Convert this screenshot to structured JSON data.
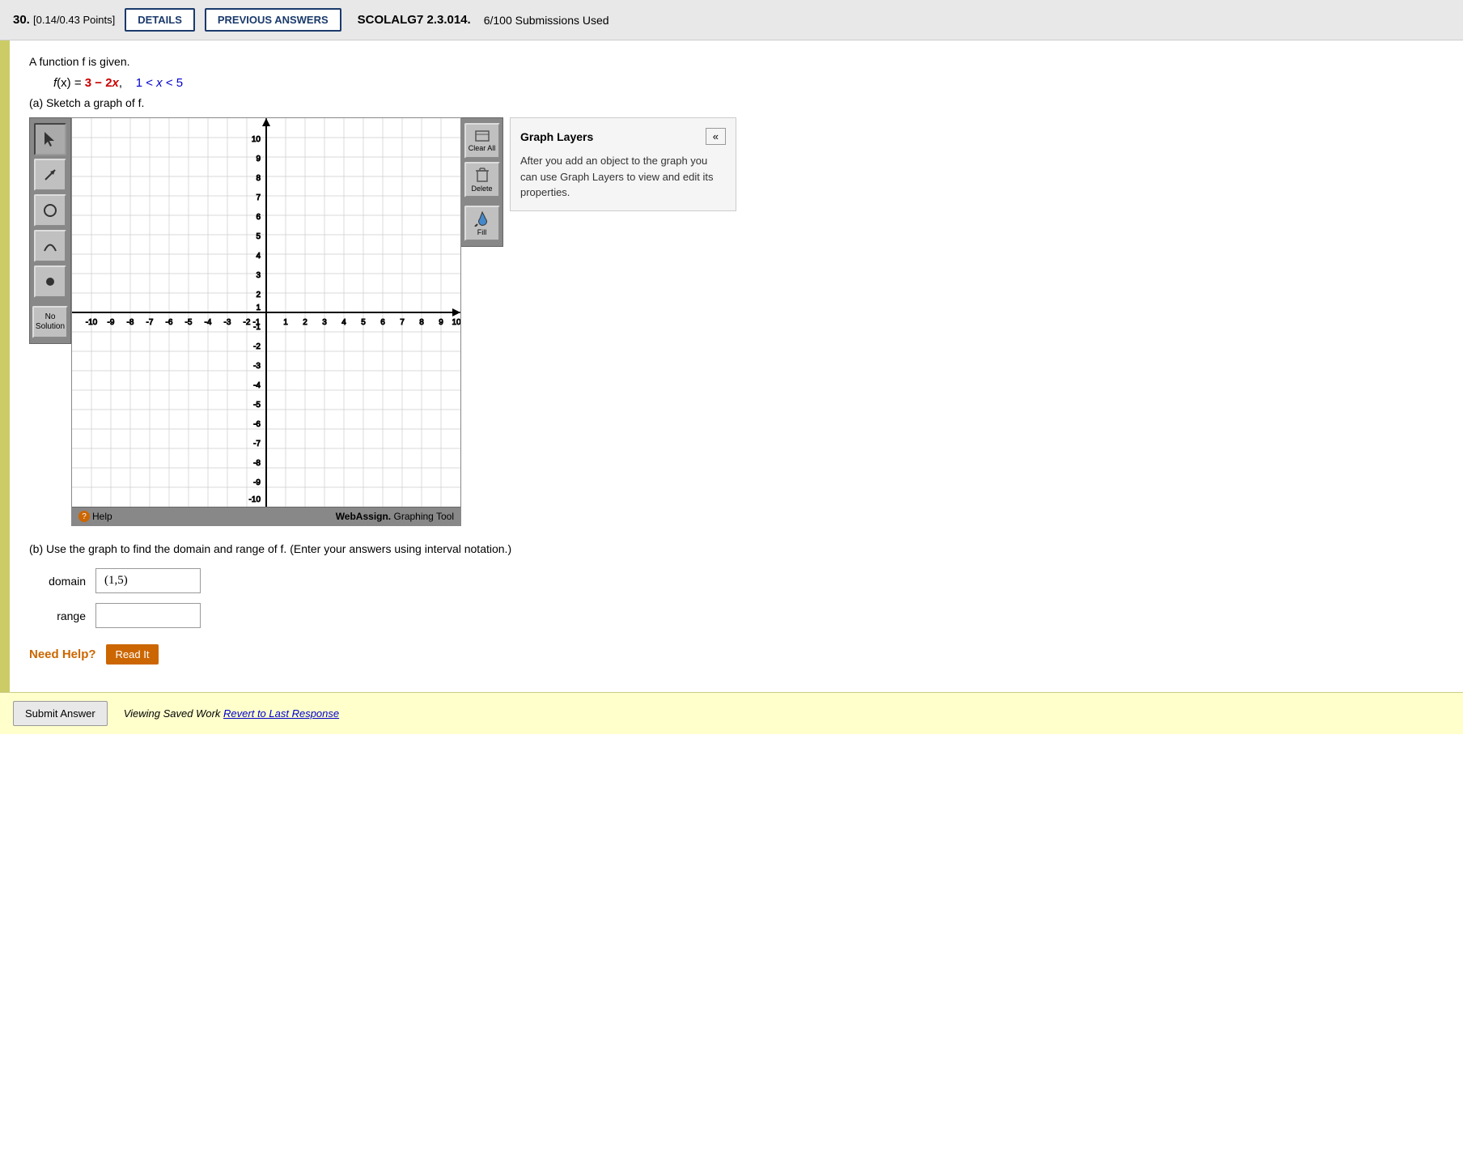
{
  "header": {
    "question_number": "30.",
    "points": "[0.14/0.43 Points]",
    "details_label": "DETAILS",
    "prev_answers_label": "PREVIOUS ANSWERS",
    "course_code": "SCOLALG7 2.3.014.",
    "submissions": "6/100 Submissions Used"
  },
  "problem": {
    "statement": "A function f is given.",
    "function_display": "f(x) = 3 − 2x,    1 < x < 5",
    "part_a_label": "(a) Sketch a graph of f.",
    "part_b_label": "(b) Use the graph to find the domain and range of f. (Enter your answers using interval notation.)"
  },
  "toolbar": {
    "cursor_tool": "▲",
    "arrow_tool": "↗",
    "circle_tool": "○",
    "parabola_tool": "∪",
    "dot_tool": "●",
    "no_solution_label": "No\nSolution"
  },
  "side_panel": {
    "clear_all_label": "Clear All",
    "delete_label": "Delete",
    "fill_label": "Fill"
  },
  "graph_layers": {
    "title": "Graph Layers",
    "collapse_icon": "«",
    "description": "After you add an object to the graph you can use Graph Layers to view and edit its properties."
  },
  "graph": {
    "x_min": -10,
    "x_max": 10,
    "y_min": -10,
    "y_max": 10,
    "x_labels": [
      "-10",
      "-9",
      "-8",
      "-7",
      "-6",
      "-5",
      "-4",
      "-3",
      "-2",
      "-1",
      "1",
      "2",
      "3",
      "4",
      "5",
      "6",
      "7",
      "8",
      "9",
      "10"
    ],
    "y_labels": [
      "-10",
      "-9",
      "-8",
      "-7",
      "-6",
      "-5",
      "-4",
      "-3",
      "-2",
      "-1",
      "1",
      "2",
      "3",
      "4",
      "5",
      "6",
      "7",
      "8",
      "9",
      "10"
    ]
  },
  "webassign_credit": "WebAssign. Graphing Tool",
  "help_label": "Help",
  "answers": {
    "domain_label": "domain",
    "domain_value": "(1,5)",
    "range_label": "range",
    "range_value": ""
  },
  "need_help": {
    "label": "Need Help?",
    "read_it_label": "Read It"
  },
  "footer": {
    "submit_label": "Submit Answer",
    "viewing_text": "Viewing Saved Work",
    "revert_text": "Revert to Last Response"
  }
}
